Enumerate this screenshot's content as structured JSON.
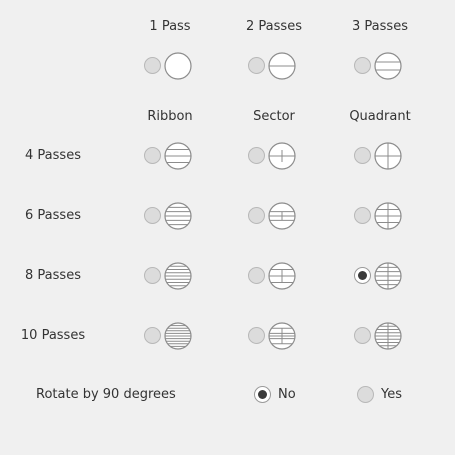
{
  "columns_top": [
    "1 Pass",
    "2 Passes",
    "3 Passes"
  ],
  "columns": [
    "Ribbon",
    "Sector",
    "Quadrant"
  ],
  "rows": [
    "4 Passes",
    "6 Passes",
    "8 Passes",
    "10 Passes"
  ],
  "selected_pattern": {
    "row": "8 Passes",
    "column": "Quadrant"
  },
  "rotate": {
    "label": "Rotate by 90 degrees",
    "options": [
      "No",
      "Yes"
    ],
    "selected": "No"
  },
  "colors": {
    "background": "#f0f0f0",
    "text": "#333333",
    "diagram_stroke": "#8c8c8c",
    "radio_off": "#dcdcdc",
    "radio_dot": "#3a3a3a"
  }
}
